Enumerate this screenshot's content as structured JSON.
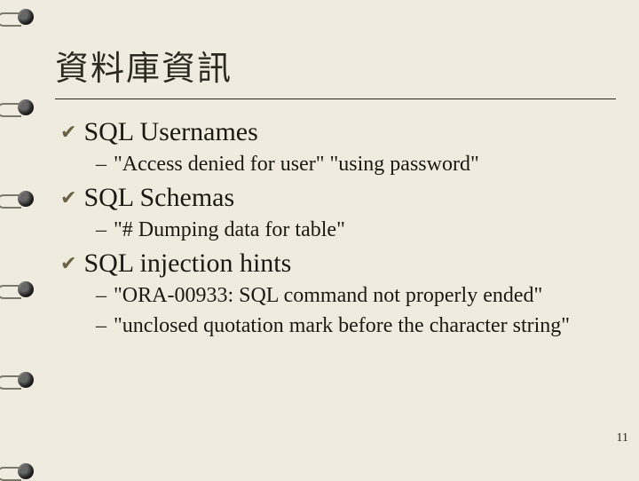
{
  "title": "資料庫資訊",
  "sections": [
    {
      "heading": "SQL Usernames",
      "items": [
        "\"Access denied for user\" \"using password\""
      ]
    },
    {
      "heading": "SQL Schemas",
      "items": [
        "\"# Dumping data for table\""
      ]
    },
    {
      "heading": "SQL injection hints",
      "items": [
        "\"ORA-00933: SQL command not properly ended\"",
        "\"unclosed quotation mark before the character string\""
      ]
    }
  ],
  "page_number": "11"
}
